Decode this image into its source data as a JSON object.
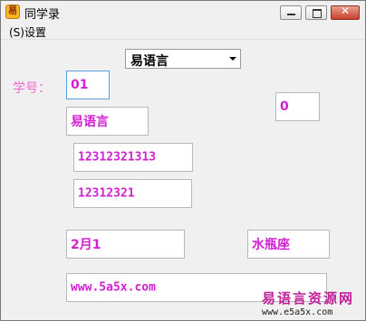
{
  "window": {
    "title": "同学录",
    "app_icon_glyph": "易"
  },
  "menu": {
    "settings": "(S)设置"
  },
  "combo": {
    "value": "易语言"
  },
  "student_id": {
    "label": "学号：",
    "value": "01"
  },
  "fields": {
    "name": "易语言",
    "number_box": "0",
    "phone": "12312321313",
    "qq": "12312321",
    "birthday": "2月1",
    "zodiac": "水瓶座",
    "website": "www.5a5x.com"
  },
  "watermark": {
    "title": "易语言资源网",
    "url": "www.e5a5x.com"
  },
  "colors": {
    "accent": "#d020d0",
    "label": "#f06acb"
  }
}
